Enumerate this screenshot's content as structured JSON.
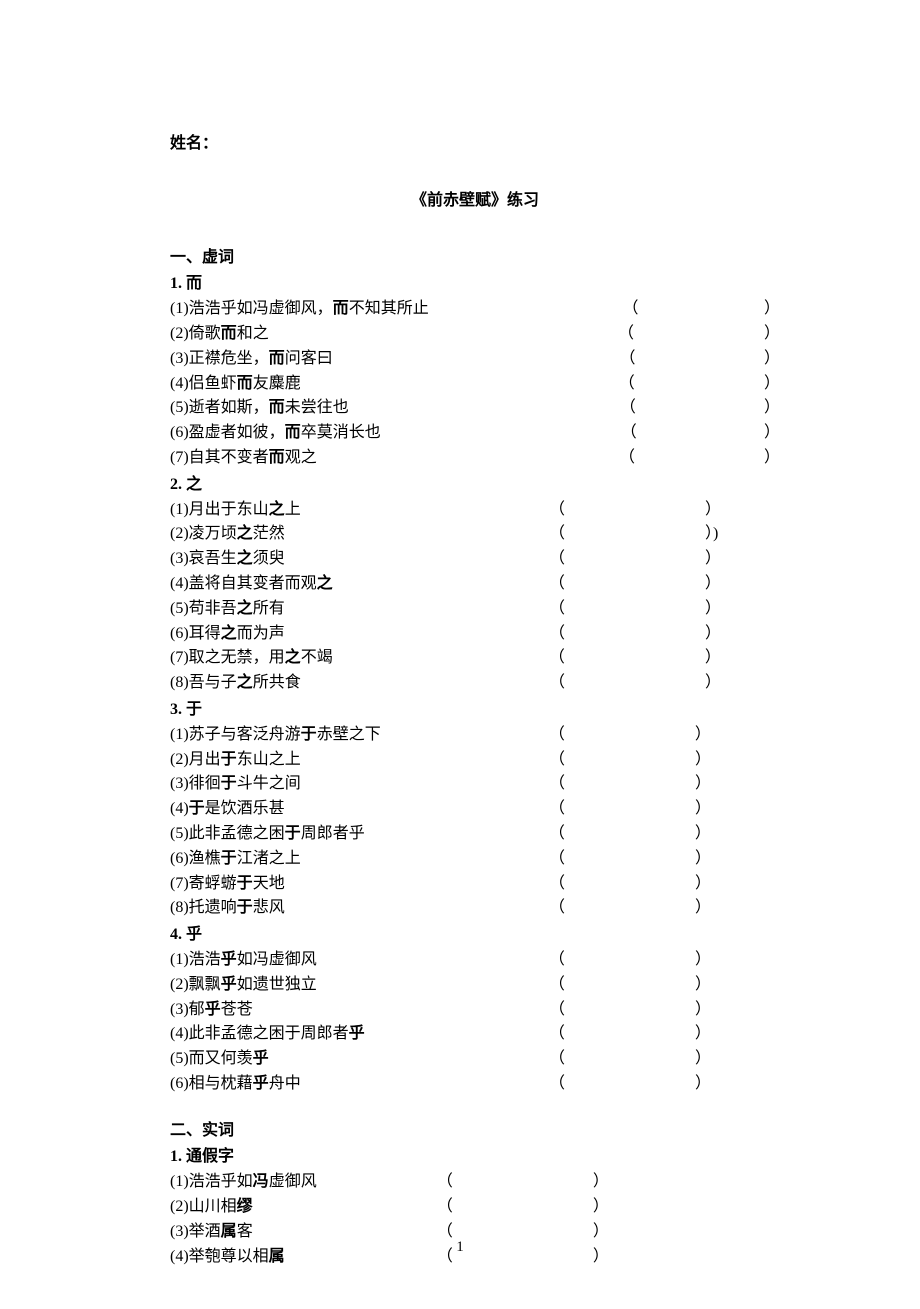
{
  "name_label": "姓名：",
  "title": "《前赤壁赋》练习",
  "section1": {
    "heading": "一、虚词",
    "groups": [
      {
        "head": "1. 而",
        "open_col": 30,
        "blank_width": 140,
        "items": [
          {
            "pre": "(1)浩浩乎如冯虚御风，",
            "bold": "而",
            "post": "不知其所止",
            "extra": ""
          },
          {
            "pre": "(2)倚歌",
            "bold": "而",
            "post": "和之",
            "extra": ""
          },
          {
            "pre": "(3)正襟危坐，",
            "bold": "而",
            "post": "问客曰",
            "extra": ""
          },
          {
            "pre": "(4)侣鱼虾",
            "bold": "而",
            "post": "友麋鹿",
            "extra": ""
          },
          {
            "pre": "(5)逝者如斯，",
            "bold": "而",
            "post": "未尝往也",
            "extra": ""
          },
          {
            "pre": "(6)盈虚者如彼，",
            "bold": "而",
            "post": "卒莫消长也",
            "extra": ""
          },
          {
            "pre": "(7)自其不变者",
            "bold": "而",
            "post": "观之",
            "extra": ""
          }
        ]
      },
      {
        "head": "2. 之",
        "open_col": 24,
        "blank_width": 140,
        "items": [
          {
            "pre": "(1)月出于东山",
            "bold": "之",
            "post": "上",
            "extra": ""
          },
          {
            "pre": "(2)凌万顷",
            "bold": "之",
            "post": "茫然",
            "extra": ")"
          },
          {
            "pre": "(3)哀吾生",
            "bold": "之",
            "post": "须臾",
            "extra": ""
          },
          {
            "pre": "(4)盖将自其变者而观",
            "bold": "之",
            "post": "",
            "extra": ""
          },
          {
            "pre": "(5)苟非吾",
            "bold": "之",
            "post": "所有",
            "extra": ""
          },
          {
            "pre": "(6)耳得",
            "bold": "之",
            "post": "而为声",
            "extra": ""
          },
          {
            "pre": "(7)取之无禁，用",
            "bold": "之",
            "post": "不竭",
            "extra": ""
          },
          {
            "pre": "(8)吾与子",
            "bold": "之",
            "post": "所共食",
            "extra": ""
          }
        ]
      },
      {
        "head": "3. 于",
        "open_col": 24,
        "blank_width": 130,
        "items": [
          {
            "pre": "(1)苏子与客泛舟游",
            "bold": "于",
            "post": "赤壁之下",
            "extra": ""
          },
          {
            "pre": "(2)月出",
            "bold": "于",
            "post": "东山之上",
            "extra": ""
          },
          {
            "pre": "(3)徘徊",
            "bold": "于",
            "post": "斗牛之间",
            "extra": ""
          },
          {
            "pre": "(4)",
            "bold": "于",
            "post": "是饮酒乐甚",
            "extra": ""
          },
          {
            "pre": "(5)此非孟德之困",
            "bold": "于",
            "post": "周郎者乎",
            "extra": ""
          },
          {
            "pre": "(6)渔樵",
            "bold": "于",
            "post": "江渚之上",
            "extra": ""
          },
          {
            "pre": "(7)寄蜉蝣",
            "bold": "于",
            "post": "天地",
            "extra": ""
          },
          {
            "pre": "(8)托遗响",
            "bold": "于",
            "post": "悲风",
            "extra": ""
          }
        ]
      },
      {
        "head": "4. 乎",
        "open_col": 24,
        "blank_width": 130,
        "items": [
          {
            "pre": "(1)浩浩",
            "bold": "乎",
            "post": "如冯虚御风",
            "extra": ""
          },
          {
            "pre": "(2)飘飘",
            "bold": "乎",
            "post": "如遗世独立",
            "extra": ""
          },
          {
            "pre": "(3)郁",
            "bold": "乎",
            "post": "苍苍",
            "extra": ""
          },
          {
            "pre": "(4)此非孟德之困于周郎者",
            "bold": "乎",
            "post": "",
            "extra": ""
          },
          {
            "pre": "(5)而又何羡",
            "bold": "乎",
            "post": "",
            "extra": ""
          },
          {
            "pre": "(6)相与枕藉",
            "bold": "乎",
            "post": "舟中",
            "extra": ""
          }
        ]
      }
    ]
  },
  "section2": {
    "heading": "二、实词",
    "groups": [
      {
        "head": "1. 通假字",
        "open_col": 17,
        "blank_width": 140,
        "items": [
          {
            "pre": "(1)浩浩乎如",
            "bold": "冯",
            "post": "虚御风",
            "extra": ""
          },
          {
            "pre": "(2)山川相",
            "bold": "缪",
            "post": "",
            "extra": ""
          },
          {
            "pre": "(3)举酒",
            "bold": "属",
            "post": "客",
            "extra": ""
          },
          {
            "pre": "(4)举匏尊以相",
            "bold": "属",
            "post": "",
            "extra": ""
          }
        ]
      }
    ]
  },
  "page_number": "1"
}
